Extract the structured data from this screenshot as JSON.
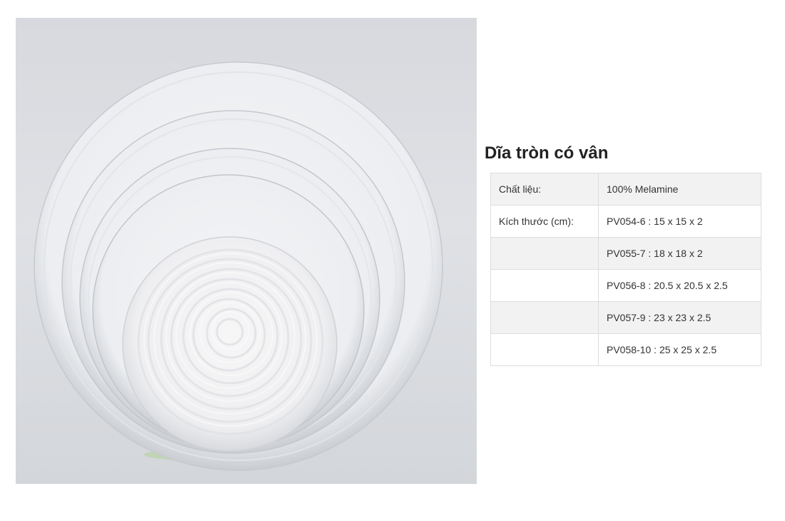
{
  "product": {
    "title": "Dĩa tròn có vân",
    "image_alt": "white melamine round plates with ripple pattern"
  },
  "specs": [
    {
      "label": "Chất liệu:",
      "value": "100% Melamine"
    },
    {
      "label": "Kích thước (cm):",
      "value": "PV054-6 : 15 x 15 x 2"
    },
    {
      "label": "",
      "value": "PV055-7 : 18 x 18 x 2"
    },
    {
      "label": "",
      "value": "PV056-8 : 20.5 x 20.5 x 2.5"
    },
    {
      "label": "",
      "value": "PV057-9 : 23 x 23 x 2.5"
    },
    {
      "label": "",
      "value": "PV058-10 : 25 x 25 x 2.5"
    }
  ]
}
